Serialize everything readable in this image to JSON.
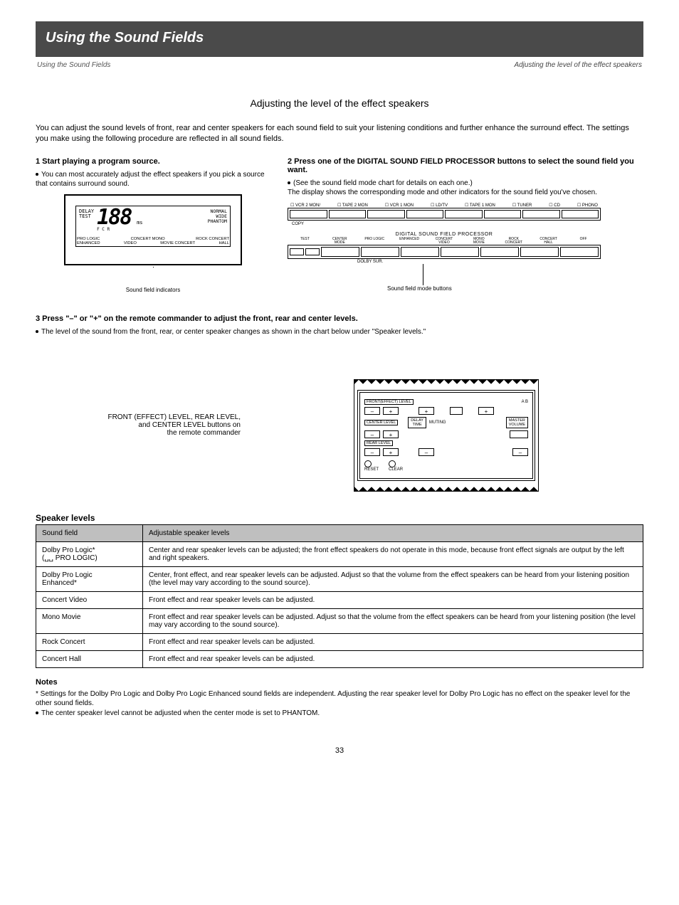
{
  "header": {
    "bar": "Using the Sound Fields",
    "left": "Using the Sound Fields",
    "right": "Adjusting the level of the effect speakers"
  },
  "section_title": "Adjusting the level of the effect speakers",
  "intro": "You can adjust the sound levels of front, rear and center speakers for each sound field to suit your listening conditions and further enhance the surround effect. The settings you make using the following procedure are reflected in all sound fields.",
  "steps": {
    "s1": {
      "h": "1  Start playing a program source.",
      "body": "You can most accurately adjust the effect speakers if you pick a source that contains surround sound."
    },
    "s2": {
      "h": "2  Press one of the DIGITAL SOUND FIELD PROCESSOR buttons to select the sound field you want.",
      "body": "(See the sound field mode chart for details on each one.)\nThe display shows the corresponding mode and other indicators for the sound field you've chosen."
    }
  },
  "lcd": {
    "delay": "DELAY",
    "test": "TEST",
    "value": "188",
    "ms": "ms",
    "fcr": "F C R",
    "right": {
      "normal": "NORMAL",
      "wide": "WIDE",
      "phantom": "PHANTOM"
    },
    "bottom1a": "PRO LOGIC",
    "bottom1b": "CONCERT MONO",
    "bottom1c": "ROCK CONCERT",
    "bottom2a": "ENHANCED",
    "bottom2b": "VIDEO",
    "bottom2c": "MOVIE CONCERT",
    "bottom2d": "HALL",
    "caption": "Sound field indicators"
  },
  "panel": {
    "inputs": {
      "a": "VCR 2 MON/",
      "b": "TAPE 2 MON",
      "c": "VCR 1 MON",
      "d": "LD/TV",
      "e": "TAPE 1 MON",
      "f": "TUNER",
      "g": "CD",
      "h": "PHONO"
    },
    "copy": "COPY",
    "dsp_label": "DIGITAL SOUND FIELD PROCESSOR",
    "dsp_btns": {
      "test": "TEST",
      "center_mode": "CENTER\nMODE",
      "pro_logic": "PRO LOGIC",
      "enhanced": "ENHANCED",
      "concert_video": "CONCERT\nVIDEO",
      "mono_movie": "MONO\nMOVIE",
      "rock_concert": "ROCK\nCONCERT",
      "concert_hall": "CONCERT\nHALL",
      "off": "OFF"
    },
    "dolby": "DOLBY SUR.",
    "caption": "Sound field mode buttons"
  },
  "step3": {
    "h": "3  Press \"–\" or \"+\" on the remote commander to adjust the front, rear and center levels.",
    "body": "The level of the sound from the front, rear, or center speaker changes as shown in the chart below under \"Speaker levels.\""
  },
  "remote": {
    "label": "FRONT (EFFECT) LEVEL, REAR LEVEL,\nand CENTER LEVEL buttons on\nthe remote commander",
    "front_effect": "FRONT(EFFECT) LEVEL",
    "center": "CENTER LEVEL",
    "rear": "REAR LEVEL",
    "ab": "A   B",
    "muting": "MUTING",
    "delay_time": "DELAY\nTIME",
    "master_volume": "MASTER\nVOLUME",
    "plus": "+",
    "minus": "–",
    "reset": "RESET",
    "clear": "CLEAR"
  },
  "table": {
    "title": "Speaker levels",
    "h1": "Sound field",
    "h2": "Adjustable speaker levels",
    "r1a": "Dolby Pro Logic*\n(␣␣ PRO LOGIC)",
    "r1b": "Center and rear speaker levels can be adjusted; the front effect speakers do not operate in this mode, because front effect signals are output by the left and right speakers.",
    "r2a": "Dolby Pro Logic\nEnhanced*",
    "r2b": "Center, front effect, and rear speaker levels can be adjusted. Adjust so that the volume from the effect speakers can be heard from your listening position (the level may vary according to the sound source).",
    "r3a": "Concert Video",
    "r3b": "Front effect and rear speaker levels can be adjusted.",
    "r4a": "Mono Movie",
    "r4b": "Front effect and rear speaker levels can be adjusted. Adjust so that the volume from the effect speakers can be heard from your listening position (the level may vary according to the sound source).",
    "r5a": "Rock Concert",
    "r5b": "Front effect and rear speaker levels can be adjusted.",
    "r6a": "Concert Hall",
    "r6b": "Front effect and rear speaker levels can be adjusted."
  },
  "notes_h": "Notes",
  "note1": "Settings for the Dolby Pro Logic and Dolby Pro Logic Enhanced sound fields are independent. Adjusting the rear speaker level for Dolby Pro Logic has no effect on the speaker level for the other sound fields.",
  "note2": "The center speaker level cannot be adjusted when the center mode is set to PHANTOM.",
  "pgnum": "33"
}
